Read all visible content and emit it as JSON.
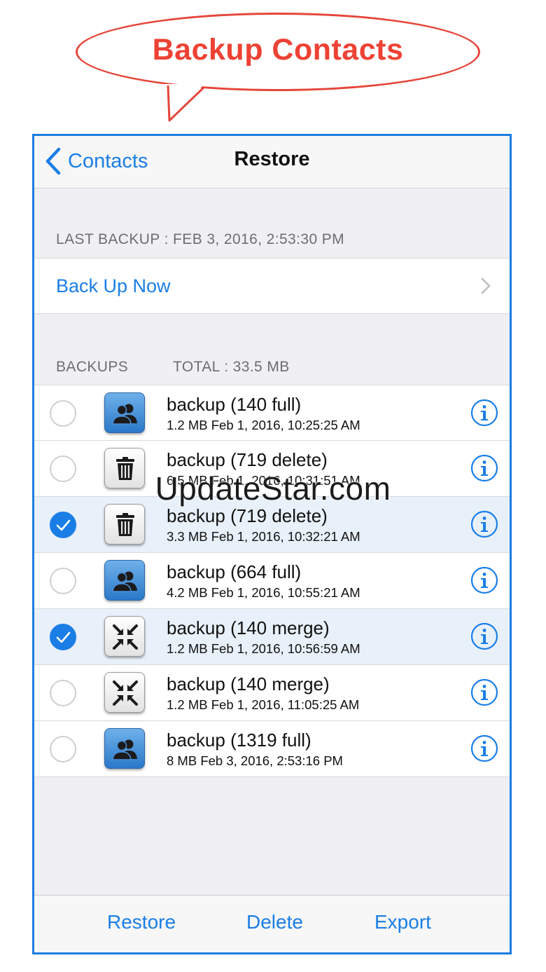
{
  "banner": {
    "title": "Backup Contacts"
  },
  "nav": {
    "back_label": "Contacts",
    "title": "Restore"
  },
  "last_backup": {
    "header": "LAST BACKUP : FEB 3, 2016, 2:53:30 PM",
    "action_label": "Back Up Now"
  },
  "backups": {
    "header_label": "BACKUPS",
    "total_label": "TOTAL : 33.5 MB",
    "items": [
      {
        "title": "backup (140 full)",
        "subtitle": "1.2 MB  Feb 1, 2016, 10:25:25 AM",
        "type": "full",
        "selected": false
      },
      {
        "title": "backup (719 delete)",
        "subtitle": "6.5 MB  Feb 1, 2016, 10:31:51 AM",
        "type": "delete",
        "selected": false
      },
      {
        "title": "backup (719 delete)",
        "subtitle": "3.3 MB  Feb 1, 2016, 10:32:21 AM",
        "type": "delete",
        "selected": true
      },
      {
        "title": "backup (664 full)",
        "subtitle": "4.2 MB  Feb 1, 2016, 10:55:21 AM",
        "type": "full",
        "selected": false
      },
      {
        "title": "backup (140 merge)",
        "subtitle": "1.2 MB  Feb 1, 2016, 10:56:59 AM",
        "type": "merge",
        "selected": true
      },
      {
        "title": "backup (140 merge)",
        "subtitle": "1.2 MB  Feb 1, 2016, 11:05:25 AM",
        "type": "merge",
        "selected": false
      },
      {
        "title": "backup (1319 full)",
        "subtitle": "8 MB  Feb 3, 2016, 2:53:16 PM",
        "type": "full",
        "selected": false
      }
    ]
  },
  "toolbar": {
    "restore_label": "Restore",
    "delete_label": "Delete",
    "export_label": "Export"
  },
  "watermark": "UpdateStar.com",
  "colors": {
    "accent": "#1a7ee6",
    "banner": "#ec4234",
    "selected_row": "#e8f0fa"
  },
  "icons": {
    "back": "chevron-left-icon",
    "disclosure": "chevron-right-icon",
    "full": "contacts-group-icon",
    "delete": "trash-icon",
    "merge": "merge-arrows-icon",
    "info": "info-icon",
    "check": "checkmark-icon"
  }
}
